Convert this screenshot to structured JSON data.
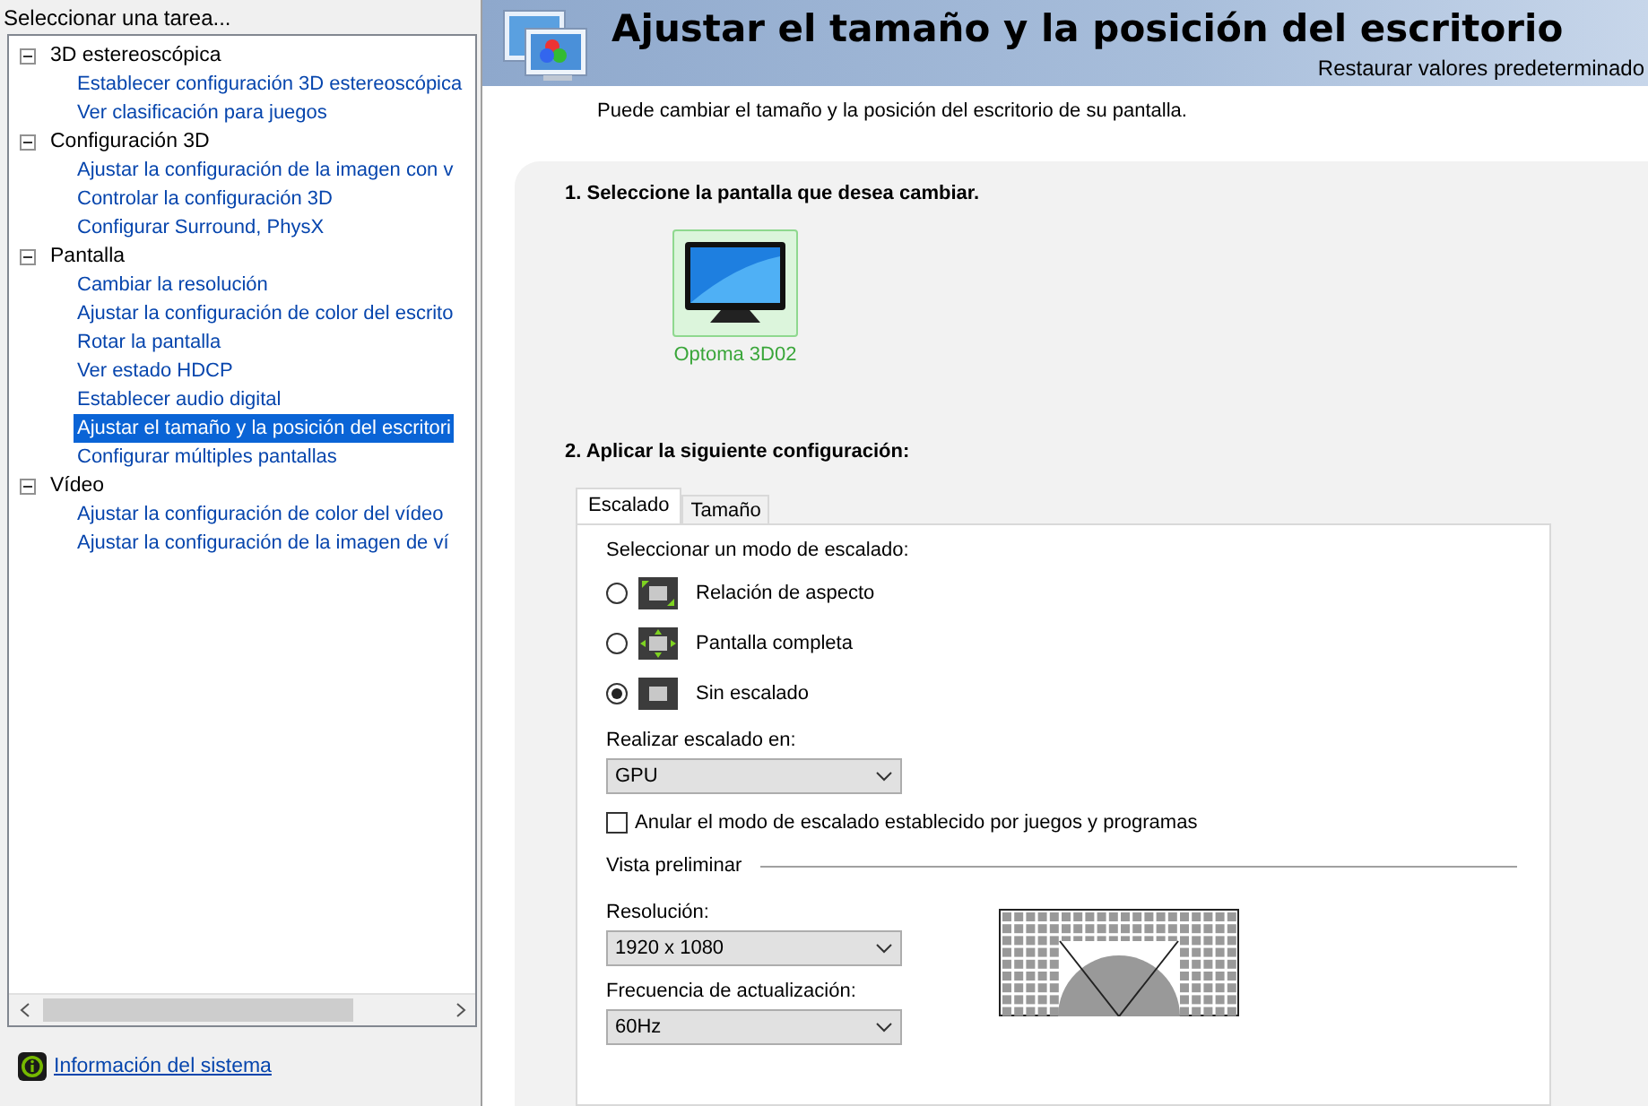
{
  "sidebar": {
    "title": "Seleccionar una tarea...",
    "tree": [
      {
        "label": "3D estereoscópica",
        "expanded": true,
        "children": [
          {
            "label": "Establecer configuración 3D estereoscópica",
            "selected": false
          },
          {
            "label": "Ver clasificación para juegos",
            "selected": false
          }
        ]
      },
      {
        "label": "Configuración 3D",
        "expanded": true,
        "children": [
          {
            "label": "Ajustar la configuración de la imagen con v",
            "selected": false
          },
          {
            "label": "Controlar la configuración 3D",
            "selected": false
          },
          {
            "label": "Configurar Surround, PhysX",
            "selected": false
          }
        ]
      },
      {
        "label": "Pantalla",
        "expanded": true,
        "children": [
          {
            "label": "Cambiar la resolución",
            "selected": false
          },
          {
            "label": "Ajustar la configuración de color del escrito",
            "selected": false
          },
          {
            "label": "Rotar la pantalla",
            "selected": false
          },
          {
            "label": "Ver estado HDCP",
            "selected": false
          },
          {
            "label": "Establecer audio digital",
            "selected": false
          },
          {
            "label": "Ajustar el tamaño y la posición del escritori",
            "selected": true
          },
          {
            "label": "Configurar múltiples pantallas",
            "selected": false
          }
        ]
      },
      {
        "label": "Vídeo",
        "expanded": true,
        "children": [
          {
            "label": "Ajustar la configuración de color del vídeo",
            "selected": false
          },
          {
            "label": "Ajustar la configuración de la imagen de ví",
            "selected": false
          }
        ]
      }
    ],
    "footer_link": "Información del sistema"
  },
  "header": {
    "title": "Ajustar el tamaño y la posición del escritorio",
    "restore_link": "Restaurar valores predeterminado"
  },
  "description": "Puede cambiar el tamaño y la posición del escritorio de su pantalla.",
  "step1": {
    "title": "1. Seleccione la pantalla que desea cambiar.",
    "displays": [
      {
        "name": "Optoma 3D02",
        "selected": true
      }
    ]
  },
  "step2": {
    "title": "2. Aplicar la siguiente configuración:",
    "tabs": [
      {
        "label": "Escalado",
        "selected": true
      },
      {
        "label": "Tamaño",
        "selected": false
      }
    ],
    "mode_label": "Seleccionar un modo de escalado:",
    "modes": [
      {
        "kind": "aspect",
        "label": "Relación de aspecto",
        "selected": false
      },
      {
        "kind": "full",
        "label": "Pantalla completa",
        "selected": false
      },
      {
        "kind": "none",
        "label": "Sin escalado",
        "selected": true
      }
    ],
    "scale_on_label": "Realizar escalado en:",
    "scale_on_value": "GPU",
    "override": {
      "label": "Anular el modo de escalado establecido por juegos y programas",
      "checked": false
    },
    "preview_title": "Vista preliminar",
    "resolution_label": "Resolución:",
    "resolution_value": "1920 x 1080",
    "refresh_label": "Frecuencia de actualización:",
    "refresh_value": "60Hz"
  }
}
